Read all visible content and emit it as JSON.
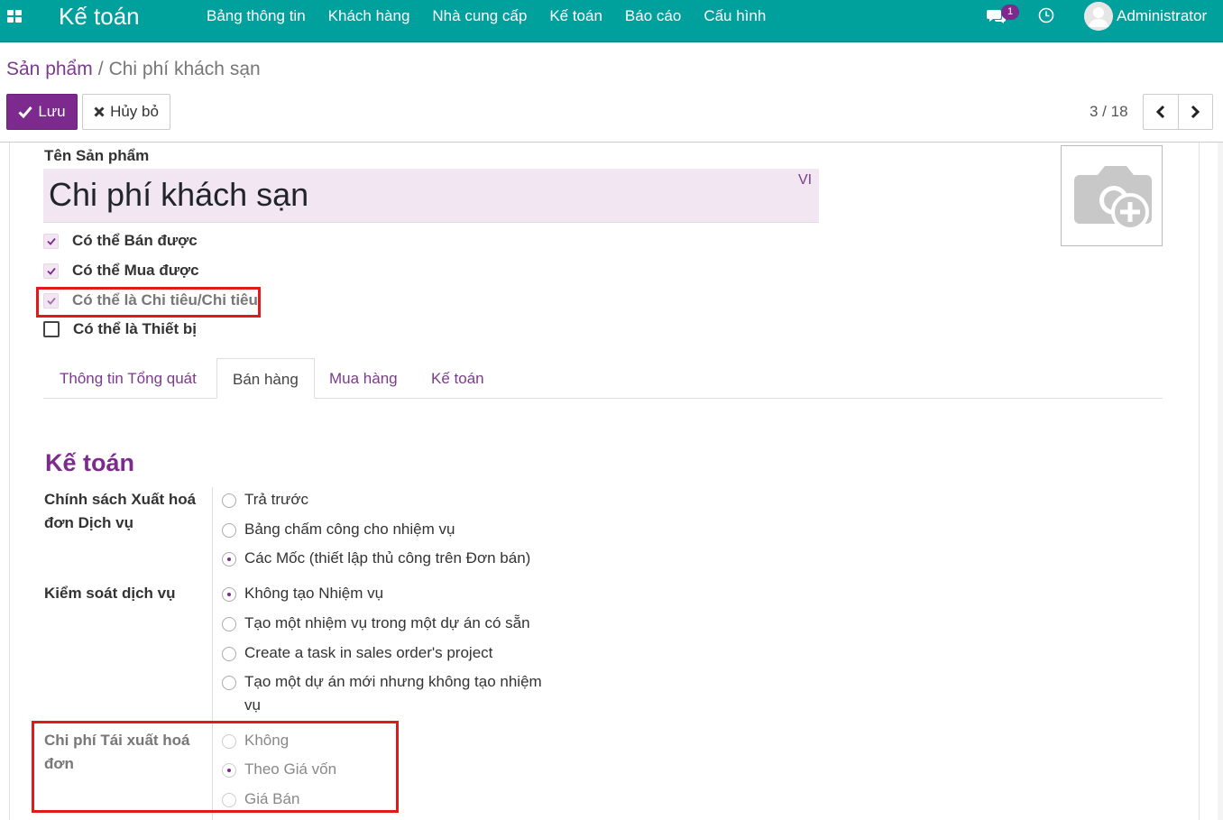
{
  "navbar": {
    "brand": "Kế toán",
    "menu": [
      "Bảng thông tin",
      "Khách hàng",
      "Nhà cung cấp",
      "Kế toán",
      "Báo cáo",
      "Cấu hình"
    ],
    "chat_badge": "1",
    "user": "Administrator"
  },
  "breadcrumb": {
    "parent": "Sản phẩm",
    "separator": "/",
    "current": "Chi phí khách sạn"
  },
  "toolbar": {
    "save_label": "Lưu",
    "cancel_label": "Hủy bỏ"
  },
  "pager": {
    "value": "3 / 18"
  },
  "form": {
    "name_label": "Tên Sản phẩm",
    "name_value": "Chi phí khách sạn",
    "lang": "VI",
    "checks": [
      {
        "label": "Có thể Bán được",
        "checked": true
      },
      {
        "label": "Có thể Mua được",
        "checked": true
      },
      {
        "label": "Có thể là Chi tiêu/Chi tiêu",
        "checked": true
      },
      {
        "label": "Có thể là Thiết bị",
        "checked": false
      }
    ],
    "tabs": [
      "Thông tin Tổng quát",
      "Bán hàng",
      "Mua hàng",
      "Kế toán"
    ],
    "active_tab": "Bán hàng",
    "section_title": "Kế toán",
    "invoice_policy": {
      "label_line1": "Chính sách Xuất hoá",
      "label_line2": "đơn Dịch vụ",
      "options": [
        "Trả trước",
        "Bảng chấm công cho nhiệm vụ",
        "Các Mốc (thiết lập thủ công trên Đơn bán)"
      ],
      "selected": "Các Mốc (thiết lập thủ công trên Đơn bán)"
    },
    "service_tracking": {
      "label": "Kiểm soát dịch vụ",
      "options": [
        "Không tạo Nhiệm vụ",
        "Tạo một nhiệm vụ trong một dự án có sẵn",
        "Create a task in sales order's project",
        "Tạo một dự án mới nhưng không tạo nhiệm",
        "vụ"
      ],
      "selected": "Không tạo Nhiệm vụ"
    },
    "reinvoice": {
      "label_line1": "Chi phí Tái xuất hoá",
      "label_line2": "đơn",
      "options": [
        "Không",
        "Theo Giá vốn",
        "Giá Bán"
      ],
      "selected": "Theo Giá vốn"
    }
  },
  "colors": {
    "navbar": "#00a09d",
    "primary": "#7c2a8d",
    "highlight": "#e01a1a",
    "field_bg": "#f3e6f3"
  }
}
